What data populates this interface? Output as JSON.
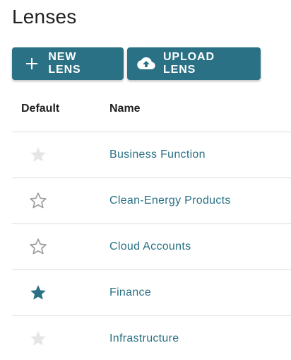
{
  "page": {
    "title": "Lenses"
  },
  "toolbar": {
    "new_label": "NEW LENS",
    "upload_label": "UPLOAD LENS"
  },
  "table": {
    "headers": {
      "default": "Default",
      "name": "Name"
    },
    "rows": [
      {
        "name": "Business Function",
        "default_state": "disabled"
      },
      {
        "name": "Clean-Energy Products",
        "default_state": "off"
      },
      {
        "name": "Cloud Accounts",
        "default_state": "off"
      },
      {
        "name": "Finance",
        "default_state": "on"
      },
      {
        "name": "Infrastructure",
        "default_state": "disabled"
      }
    ]
  },
  "colors": {
    "accent": "#2a7185",
    "star_on": "#2a7185",
    "star_off": "#9e9e9e",
    "star_disabled": "#e6e6e6",
    "divider": "#dcdcdc"
  }
}
